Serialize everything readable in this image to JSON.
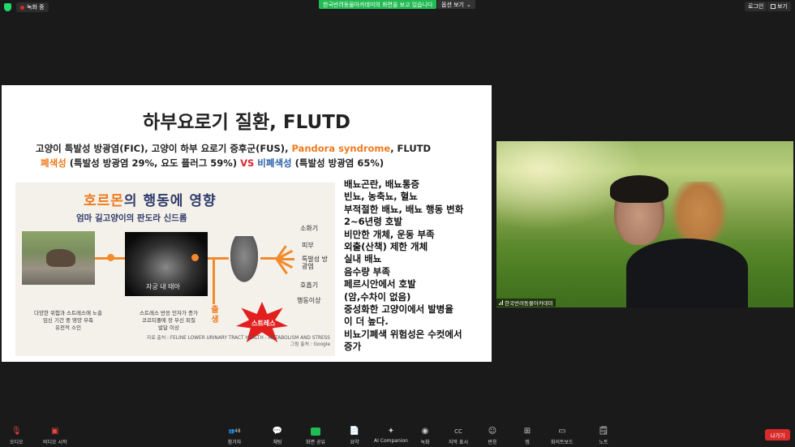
{
  "topbar": {
    "recording_label": "녹화 중",
    "share_banner": "한국반려동물아카데미의 화면을 보고 있습니다",
    "view_options": "옵션 보기",
    "login": "로그인",
    "view": "보기"
  },
  "slide": {
    "title": "하부요로기 질환, FLUTD",
    "line1_a": "고양이 특발성 방광염(FIC), 고양이 하부 요로기 증후군(FUS), ",
    "line1_b": "Pandora syndrome",
    "line1_c": ", FLUTD",
    "line2_a": "폐색성",
    "line2_b": " (특발성 방광염 29%, 요도 플러그 59%) ",
    "line2_vs": "VS",
    "line2_c": " 비폐색성",
    "line2_d": " (특발성 방광염 65%)",
    "infographic": {
      "title_a": "호르몬",
      "title_b": "의 행동에 영향",
      "subtitle": "엄마 길고양이의 판도라 신드롬",
      "ultrasound_label": "자궁 내 태아",
      "birth_label": "출생",
      "stress_label": "스트레스",
      "right_labels": [
        "소화기",
        "피부",
        "특발성 방광염",
        "호흡기",
        "행동이상"
      ],
      "caption_left": "다양한 위험과 스트레스에 노출\n임신 기간 중 영양 부족\n유전적 소인",
      "caption_mid": "스트레스 반응 인자가 증가\n코르티졸에 장 부신 피질\n발달 이상",
      "source_a": "자료 출처 : FELINE LOWER URINARY TRACT HEALTH - METABOLISM AND STRESS",
      "source_b": "그림 출처 : Google"
    },
    "symptoms": [
      "배뇨곤란, 배뇨통증",
      "빈뇨, 농축뇨, 혈뇨",
      "부적절한 배뇨, 배뇨 행동 변화",
      "2~6년령 호발",
      "비만한 개체, 운동 부족",
      "외출(산책) 제한 개체",
      "실내 배뇨",
      "음수량 부족",
      "페르시안에서 호발",
      "(암,수차이 없음)",
      "중성화한 고양이에서 발병율",
      "이 더 높다.",
      "비뇨기폐색 위험성은 수컷에서",
      "증가"
    ]
  },
  "camera": {
    "name": "한국반려동물아카데미"
  },
  "toolbar": {
    "audio": "오디오",
    "video": "비디오 시작",
    "participants": "참가자",
    "participant_count": "48",
    "chat": "채팅",
    "share": "화면 공유",
    "summary": "요약",
    "ai": "AI Companion",
    "record": "녹화",
    "captions": "자막 표시",
    "reactions": "반응",
    "apps": "앱",
    "whiteboard": "화이트보드",
    "notes": "노트",
    "leave": "나가기"
  },
  "colors": {
    "accent_orange": "#f07a1d",
    "accent_red": "#d9262c",
    "accent_blue": "#2a5ea8",
    "share_green": "#22bb53",
    "leave_red": "#d92b2b"
  }
}
